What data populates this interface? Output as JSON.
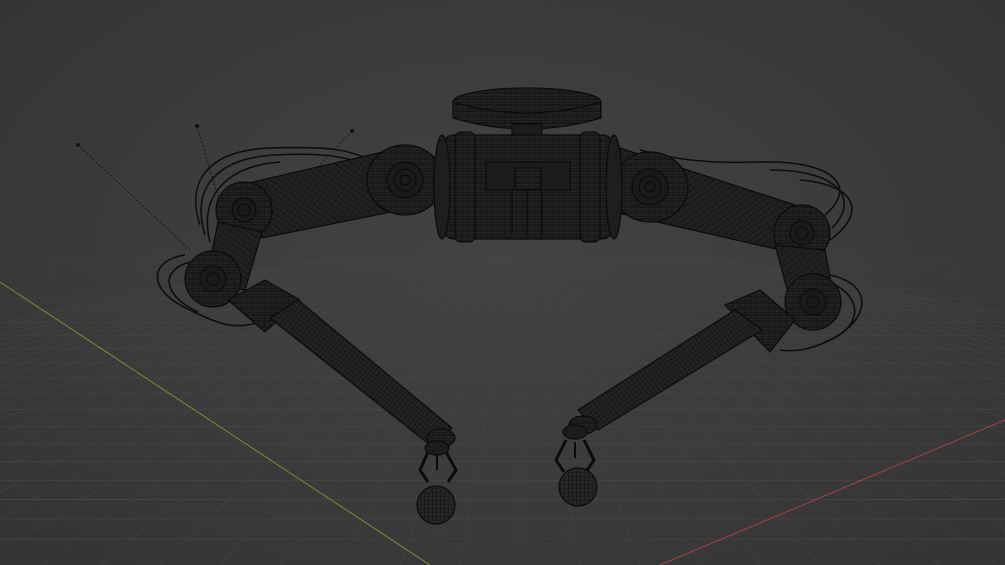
{
  "viewport": {
    "background_color": "#3d3d3d",
    "grid_color": "#4a4a4a",
    "x_axis_color": "#c2424e",
    "y_axis_color": "#8fa83a",
    "wire_color": "#0b0b0b",
    "mesh_fill_color": "#202020"
  },
  "scene": {
    "object": "robotic-dual-arm-wireframe",
    "view_mode": "wireframe",
    "lights": [
      "light-1",
      "light-2",
      "light-3"
    ]
  }
}
